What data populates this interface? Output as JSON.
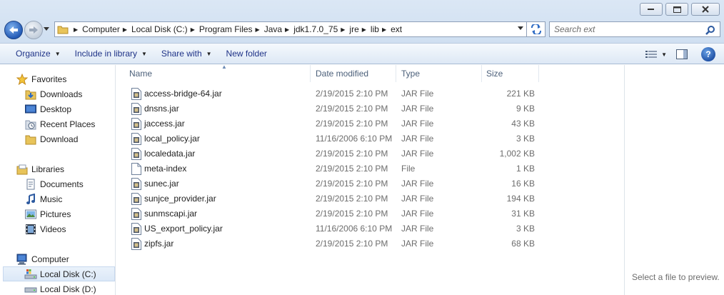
{
  "window_controls": {
    "minimize_icon": "minimize-icon",
    "maximize_icon": "maximize-icon",
    "close_icon": "close-icon"
  },
  "address": {
    "breadcrumbs": [
      "Computer",
      "Local Disk (C:)",
      "Program Files",
      "Java",
      "jdk1.7.0_75",
      "jre",
      "lib",
      "ext"
    ]
  },
  "search": {
    "placeholder": "Search ext"
  },
  "toolbar": {
    "organize": "Organize",
    "include_in_library": "Include in library",
    "share_with": "Share with",
    "new_folder": "New folder"
  },
  "nav": {
    "favorites": "Favorites",
    "favorites_items": [
      "Downloads",
      "Desktop",
      "Recent Places",
      "Download"
    ],
    "libraries": "Libraries",
    "libraries_items": [
      "Documents",
      "Music",
      "Pictures",
      "Videos"
    ],
    "computer": "Computer",
    "computer_items": [
      "Local Disk (C:)",
      "Local Disk (D:)"
    ],
    "selected": "Local Disk (C:)"
  },
  "columns": {
    "name": "Name",
    "date_modified": "Date modified",
    "type": "Type",
    "size": "Size"
  },
  "files": [
    {
      "name": "access-bridge-64.jar",
      "date": "2/19/2015 2:10 PM",
      "type": "JAR File",
      "size": "221 KB",
      "icon": "jar-file-icon"
    },
    {
      "name": "dnsns.jar",
      "date": "2/19/2015 2:10 PM",
      "type": "JAR File",
      "size": "9 KB",
      "icon": "jar-file-icon"
    },
    {
      "name": "jaccess.jar",
      "date": "2/19/2015 2:10 PM",
      "type": "JAR File",
      "size": "43 KB",
      "icon": "jar-file-icon"
    },
    {
      "name": "local_policy.jar",
      "date": "11/16/2006 6:10 PM",
      "type": "JAR File",
      "size": "3 KB",
      "icon": "jar-file-icon"
    },
    {
      "name": "localedata.jar",
      "date": "2/19/2015 2:10 PM",
      "type": "JAR File",
      "size": "1,002 KB",
      "icon": "jar-file-icon"
    },
    {
      "name": "meta-index",
      "date": "2/19/2015 2:10 PM",
      "type": "File",
      "size": "1 KB",
      "icon": "blank-file-icon"
    },
    {
      "name": "sunec.jar",
      "date": "2/19/2015 2:10 PM",
      "type": "JAR File",
      "size": "16 KB",
      "icon": "jar-file-icon"
    },
    {
      "name": "sunjce_provider.jar",
      "date": "2/19/2015 2:10 PM",
      "type": "JAR File",
      "size": "194 KB",
      "icon": "jar-file-icon"
    },
    {
      "name": "sunmscapi.jar",
      "date": "2/19/2015 2:10 PM",
      "type": "JAR File",
      "size": "31 KB",
      "icon": "jar-file-icon"
    },
    {
      "name": "US_export_policy.jar",
      "date": "11/16/2006 6:10 PM",
      "type": "JAR File",
      "size": "3 KB",
      "icon": "jar-file-icon"
    },
    {
      "name": "zipfs.jar",
      "date": "2/19/2015 2:10 PM",
      "type": "JAR File",
      "size": "68 KB",
      "icon": "jar-file-icon"
    }
  ],
  "preview": {
    "text": "Select a file to preview."
  },
  "colors": {
    "command_text": "#1e3287",
    "header_text": "#4c607a",
    "secondary_text": "#6d6d6d",
    "chrome_blue": "#dbe7f5",
    "selection": "#dbe8f7"
  }
}
